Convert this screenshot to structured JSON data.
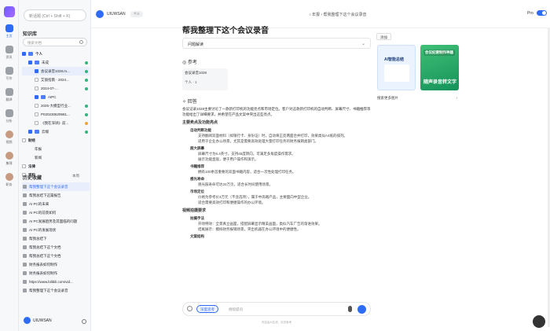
{
  "rail": {
    "items": [
      {
        "label": "主页"
      },
      {
        "label": "资讯"
      },
      {
        "label": "写作"
      },
      {
        "label": "翻译"
      },
      {
        "label": "分析"
      },
      {
        "label": "视频"
      },
      {
        "label": "集锦"
      },
      {
        "label": "职务"
      }
    ]
  },
  "panel": {
    "new_chat": "新话题 (Ctrl + Shift + K)",
    "kb_title": "知识库",
    "kb_search_placeholder": "搜索文档",
    "tree": [
      {
        "label": "个人"
      },
      {
        "label": "未成"
      },
      {
        "label": "会议录音1028.m..."
      },
      {
        "label": "艾丽指南 · 2024..."
      },
      {
        "label": "2024-07-..."
      },
      {
        "label": "AIPC"
      },
      {
        "label": "2025-大模型行业..."
      },
      {
        "label": "P020230629581..."
      },
      {
        "label": "《我在深圳》前..."
      },
      {
        "label": "云端"
      },
      {
        "label": "财经"
      },
      {
        "label": "年报"
      },
      {
        "label": "新闻"
      },
      {
        "label": "法律"
      },
      {
        "label": "资料"
      }
    ],
    "history_title": "历史收藏",
    "history_filter": "本周",
    "history": [
      "帮我整理下这个会议录音",
      "帮我总结下这篇报告",
      "AI PC的未来",
      "AI PC的前景如何",
      "AI PC发展趋势及其面临的问题",
      "AI PC的发展现状",
      "帮我总结下",
      "帮我总结下这个文档",
      "帮我总结下这个文档",
      "财务报表如何制作",
      "财务报表如何制作",
      "https://www.bilibili.com/vid...",
      "帮我整理下这个会议录音"
    ],
    "user": "UIUWSAN"
  },
  "topbar": {
    "user": "UIUWSAN",
    "tag": "个人",
    "breadcrumb": "›  年报  ›  帮我整理下这个会议录音",
    "pro_label": "Pro"
  },
  "doc": {
    "title": "帮我整理下这个会议录音",
    "question_type": "问题解读",
    "ref_heading": "参考",
    "ref_card": {
      "name": "会议录音1028",
      "sub": "个人 · 1"
    },
    "answer_heading": "回答",
    "answer_intro": "会议记录1028主要讨论了一款新打印机的功能亮点和市场定位。客户对这款新打印机的自动判断、屏幕尺寸、书籍推荐等功能给出了详细要求，并希望在产品文案中突出这些亮点。",
    "sections": [
      {
        "h": "主要卖点及功能亮点",
        "items": [
          {
            "t": "自动判断功能",
            "subs": [
              "支持翻阅双面材料（如银行卡、身份证）时，自动将正反两面合并打印，效果类似A4纸的排列。",
              "适用于企业办公场景，尤其是需要高效处理大量打印任务的财务报销类部门。"
            ]
          },
          {
            "t": "超大屏幕",
            "subs": [
              "屏幕尺寸为6.4英寸，支持45度转向，可满足多角度操作需求。",
              "展示功能直观，便于用户操作和演示。"
            ]
          },
          {
            "t": "书籍推荐",
            "subs": [
              "拥有100余首重要的双面书籍内容，适合一次性处理打印任务。"
            ]
          },
          {
            "t": "感光寿命",
            "subs": [
              "感光鼓寿命可达20万页，适合长时间使用场景。"
            ]
          },
          {
            "t": "市场定位",
            "subs": [
              "价格为参考价3万元（不含选项），属于中高端产品，主要面向中型企业。",
              "适合需要高效打印和便捷操作的办公环境。"
            ]
          }
        ]
      },
      {
        "h": "视频拍摄要求",
        "items": [
          {
            "t": "拍摄手法",
            "subs": [
              "开场特效：全景真立画面，搭配屏幕显示精美画面，类似汽车广告的渐进效果。",
              "结尾展示：模拟财务报销场景，突出机器在办公环境中的便捷性。"
            ]
          },
          {
            "t": "文案结构",
            "subs": []
          }
        ]
      }
    ]
  },
  "chat": {
    "deep_label": "深度思考",
    "placeholder": "继续提问",
    "disclaimer": "内容由AI生成，仅供参考"
  },
  "right": {
    "add_button": "添加",
    "img1_title": "AI智能总结",
    "img2_title": "会议纪要制作神器",
    "img2_big": "随声录音转文字",
    "more": "搜索更多图片"
  }
}
